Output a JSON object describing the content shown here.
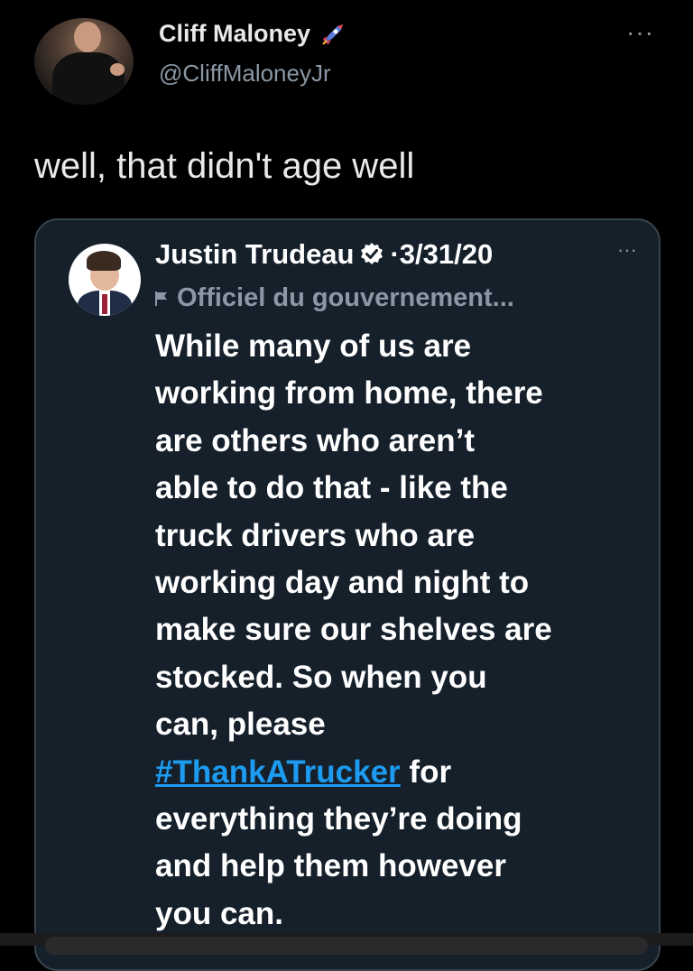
{
  "tweet": {
    "author_name": "Cliff Maloney",
    "author_handle": "@CliffMaloneyJr",
    "author_badge_icon": "rocket-icon",
    "more_label": "···",
    "text": "well, that didn't age well"
  },
  "quoted": {
    "author_name": "Justin Trudeau",
    "verified_icon": "verified-icon",
    "date": "·3/31/20",
    "more_label": "···",
    "label_icon": "flag-icon",
    "label": "Officiel du gouvernement...",
    "body_lines": [
      "While many of us are",
      "working from home, there",
      "are others who aren’t",
      "able to do that - like the",
      "truck drivers who are",
      "working day and night to",
      "make sure our shelves are",
      "stocked. So when you",
      "can, please"
    ],
    "hashtag": "#ThankATrucker",
    "hashtag_suffix": " for",
    "body_lines_after": [
      "everything they’re doing",
      "and help them however",
      "you can."
    ]
  },
  "colors": {
    "background": "#000000",
    "card_background": "#15202b",
    "link": "#1d9bf0",
    "muted": "#8b98a5"
  }
}
